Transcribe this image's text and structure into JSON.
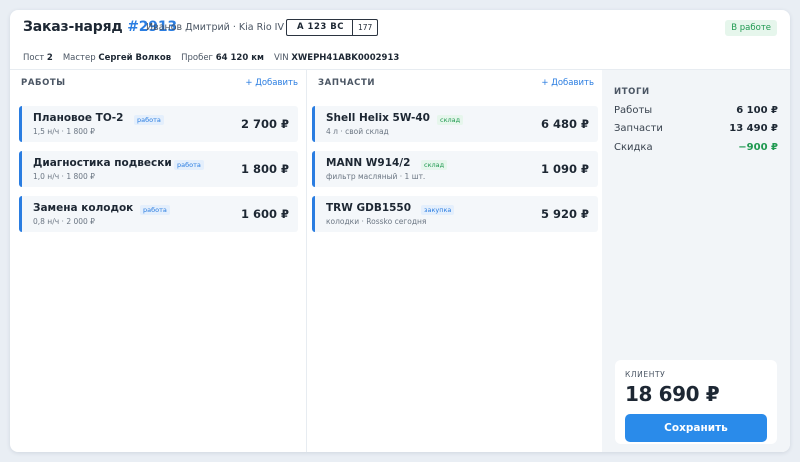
{
  "header": {
    "title_prefix": "Заказ-наряд",
    "order_number": "#2913",
    "client": "Иванов Дмитрий · Kia Rio IV",
    "plate_number": "A 123 BC",
    "plate_region": "177",
    "status": "В работе",
    "accent_color": "#2a7de1",
    "status_color": "#1f9950"
  },
  "meta": {
    "post_label": "Пост",
    "post_value": "2",
    "master_label": "Мастер",
    "master_value": "Сергей Волков",
    "mileage_label": "Пробег",
    "mileage_value": "64 120 км",
    "vin_label": "VIN",
    "vin_value": "XWEPH41ABK0002913"
  },
  "works": {
    "title": "РАБОТЫ",
    "add_label": "+ Добавить",
    "items": [
      {
        "name": "Плановое ТО-2",
        "tag": "работа",
        "detail": "1,5 н/ч · 1 800 ₽",
        "price": "2 700 ₽"
      },
      {
        "name": "Диагностика подвески",
        "tag": "работа",
        "detail": "1,0 н/ч · 1 800 ₽",
        "price": "1 800 ₽"
      },
      {
        "name": "Замена колодок",
        "tag": "работа",
        "detail": "0,8 н/ч · 2 000 ₽",
        "price": "1 600 ₽"
      }
    ]
  },
  "parts": {
    "title": "ЗАПЧАСТИ",
    "add_label": "+ Добавить",
    "items": [
      {
        "name": "Shell Helix 5W-40",
        "tag": "склад",
        "detail": "4 л · свой склад",
        "price": "6 480 ₽"
      },
      {
        "name": "MANN W914/2",
        "tag": "склад",
        "detail": "фильтр масляный · 1 шт.",
        "price": "1 090 ₽"
      },
      {
        "name": "TRW GDB1550",
        "tag": "закупка",
        "detail": "колодки · Rossko сегодня",
        "price": "5 920 ₽"
      }
    ]
  },
  "totals": {
    "title": "ИТОГИ",
    "works_label": "Работы",
    "works_value": "6 100 ₽",
    "parts_label": "Запчасти",
    "parts_value": "13 490 ₽",
    "discount_label": "Скидка",
    "discount_value": "−900 ₽",
    "client_label": "КЛИЕНТУ",
    "client_total": "18 690 ₽",
    "save_label": "Сохранить"
  }
}
